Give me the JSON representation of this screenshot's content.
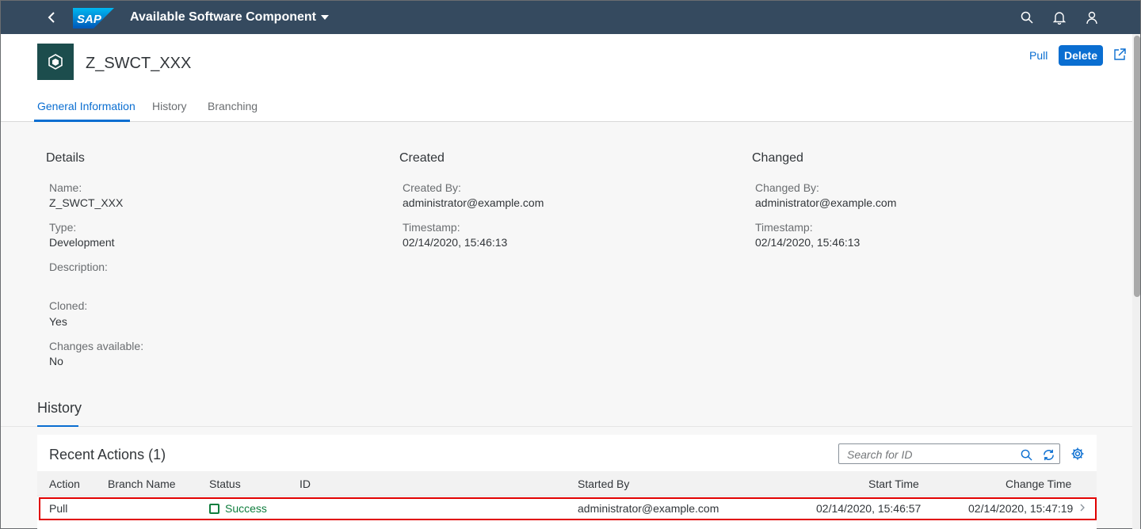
{
  "shell": {
    "title": "Available Software Component",
    "logo_text": "SAP"
  },
  "header": {
    "object_title": "Z_SWCT_XXX",
    "actions": {
      "pull": "Pull",
      "delete": "Delete"
    },
    "tabs": [
      "General Information",
      "History",
      "Branching"
    ],
    "active_tab": 0
  },
  "details": {
    "title": "Details",
    "name_label": "Name:",
    "name_value": "Z_SWCT_XXX",
    "type_label": "Type:",
    "type_value": "Development",
    "description_label": "Description:",
    "cloned_label": "Cloned:",
    "cloned_value": "Yes",
    "changes_label": "Changes available:",
    "changes_value": "No"
  },
  "created": {
    "title": "Created",
    "by_label": "Created By:",
    "by_value": "administrator@example.com",
    "ts_label": "Timestamp:",
    "ts_value": "02/14/2020, 15:46:13"
  },
  "changed": {
    "title": "Changed",
    "by_label": "Changed By:",
    "by_value": "administrator@example.com",
    "ts_label": "Timestamp:",
    "ts_value": "02/14/2020, 15:46:13"
  },
  "history": {
    "section_title": "History",
    "table_title": "Recent Actions (1)",
    "search_placeholder": "Search for ID",
    "columns": [
      "Action",
      "Branch Name",
      "Status",
      "ID",
      "Started By",
      "Start Time",
      "Change Time"
    ],
    "rows": [
      {
        "action": "Pull",
        "branch_name": "",
        "status": "Success",
        "id": "",
        "started_by": "administrator@example.com",
        "start_time": "02/14/2020, 15:46:57",
        "change_time": "02/14/2020, 15:47:19"
      }
    ]
  },
  "icons": {
    "back": "back-icon",
    "search": "search-icon",
    "notifications": "bell-icon",
    "user": "user-icon",
    "object": "cube-icon",
    "share": "share-icon",
    "refresh": "refresh-icon",
    "settings": "gear-icon",
    "row_nav": "chevron-right-icon"
  },
  "colors": {
    "shell_bg": "#354a5f",
    "accent": "#0a6ed1",
    "success": "#107e3e",
    "highlight_border": "#e00000",
    "object_icon_bg": "#1c4d4d"
  }
}
